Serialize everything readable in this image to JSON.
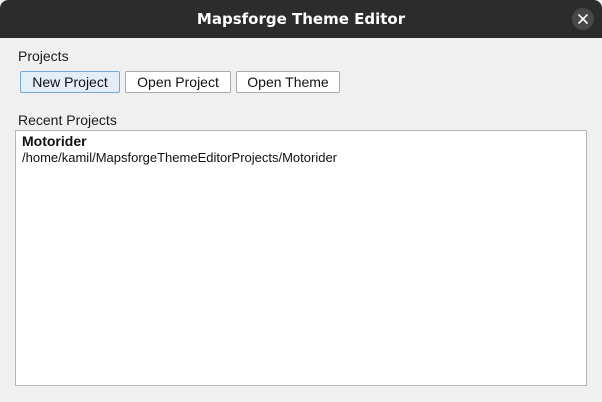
{
  "window": {
    "title": "Mapsforge Theme Editor",
    "close_icon": "close-icon"
  },
  "projects": {
    "label": "Projects",
    "buttons": {
      "new_project": "New Project",
      "open_project": "Open Project",
      "open_theme": "Open Theme"
    }
  },
  "recent": {
    "label": "Recent Projects",
    "items": [
      {
        "name": "Motorider",
        "path": "/home/kamil/MapsforgeThemeEditorProjects/Motorider"
      }
    ]
  },
  "colors": {
    "titlebar": "#2c2c2c",
    "background": "#f0f0f0",
    "focused_button": "#e4eef9"
  }
}
